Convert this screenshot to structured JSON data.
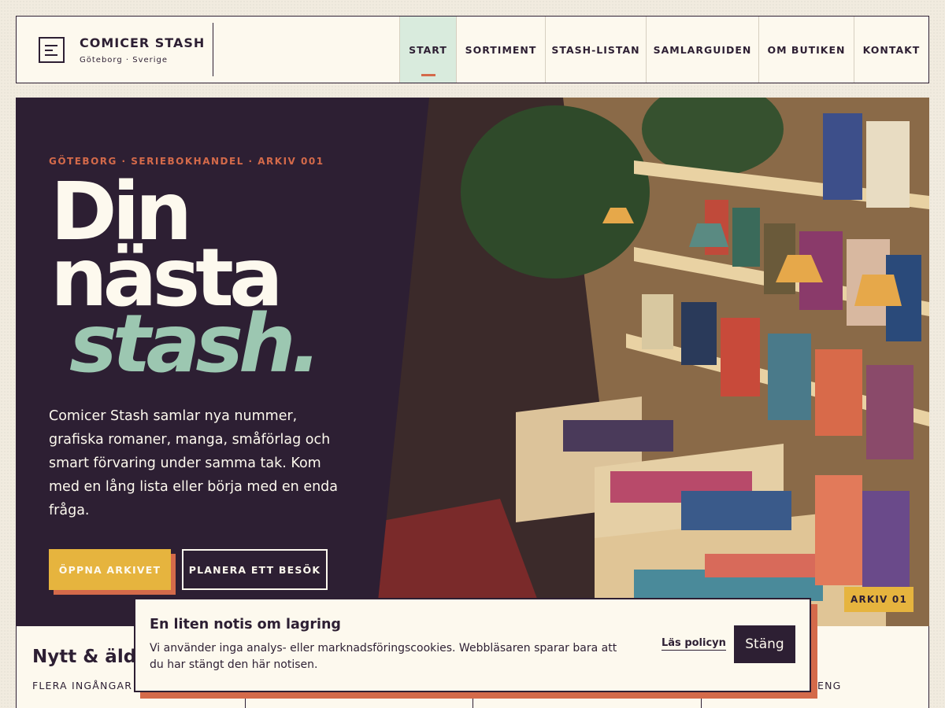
{
  "brand": {
    "name": "COMICER STASH",
    "location": "Göteborg · Sverige"
  },
  "nav": [
    {
      "label": "START",
      "active": true
    },
    {
      "label": "SORTIMENT",
      "active": false
    },
    {
      "label": "STASH-LISTAN",
      "active": false
    },
    {
      "label": "SAMLARGUIDEN",
      "active": false
    },
    {
      "label": "OM BUTIKEN",
      "active": false
    },
    {
      "label": "KONTAKT",
      "active": false
    }
  ],
  "hero": {
    "eyebrow": "GÖTEBORG · SERIEBOKHANDEL · ARKIV 001",
    "headline_line1": "Din",
    "headline_line2": "nästa",
    "headline_accent": "stash.",
    "lede": "Comicer Stash samlar nya nummer, grafiska romaner, manga, småförlag och smart förvaring under samma tak. Kom med en lång lista eller börja med en enda fråga.",
    "primary_button": "ÖPPNA ARKIVET",
    "secondary_button": "PLANERA ETT BESÖK",
    "photo_badge": "ARKIV 01"
  },
  "section": {
    "title": "Nytt & äldr",
    "subtitle": "FLERA INGÅNGAR",
    "right_subtitle": "ENG"
  },
  "cookie": {
    "title": "En liten notis om lagring",
    "text": "Vi använder inga analys- eller marknadsföringscookies. Webbläsaren sparar bara att du har stängt den här notisen.",
    "policy_link": "Läs policyn",
    "close_button": "Stäng"
  },
  "colors": {
    "ink": "#2d1f33",
    "cream": "#fdf9ee",
    "accent_orange": "#d46a4a",
    "accent_mustard": "#e6b43e",
    "accent_mint": "#9cc7b1",
    "nav_active": "#d9ebdd"
  }
}
